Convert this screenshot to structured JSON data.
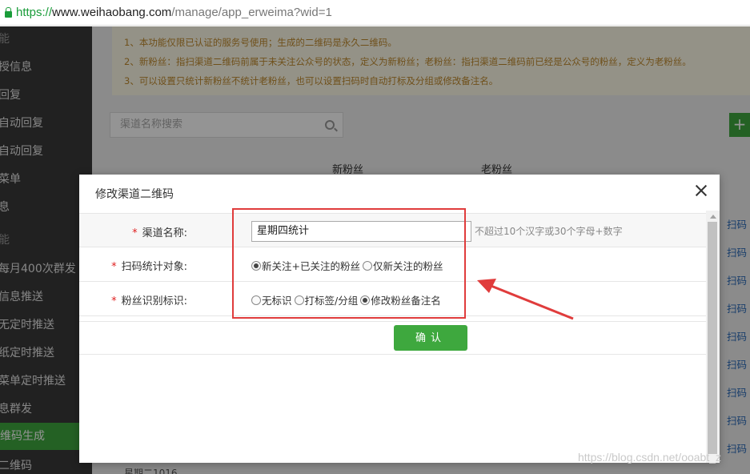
{
  "browser": {
    "url_scheme": "https://",
    "url_host": "www.weihaobang.com",
    "url_path": "/manage/app_erweima?wid=1"
  },
  "sidebar": {
    "items": [
      {
        "label": "能",
        "muted": true
      },
      {
        "label": "授信息"
      },
      {
        "label": "回复"
      },
      {
        "label": "自动回复"
      },
      {
        "label": "自动回复"
      },
      {
        "label": "菜单"
      },
      {
        "label": "息"
      },
      {
        "label": "能",
        "muted": true
      },
      {
        "label": "每月400次群发"
      },
      {
        "label": "信息推送"
      },
      {
        "label": "无定时推送"
      },
      {
        "label": "纸定时推送"
      },
      {
        "label": "菜单定时推送"
      },
      {
        "label": "息群发"
      },
      {
        "label": "维码生成",
        "active": true
      },
      {
        "label": "二维码"
      }
    ]
  },
  "main": {
    "notice_lines": [
      "1、本功能仅限已认证的服务号使用；生成的二维码是永久二维码。",
      "2、新粉丝：指扫渠道二维码前属于未关注公众号的状态，定义为新粉丝；老粉丝：指扫渠道二维码前已经是公众号的粉丝，定义为老粉丝。",
      "3、可以设置只统计新粉丝不统计老粉丝，也可以设置扫码时自动打标及分组或修改备注名。"
    ],
    "search_placeholder": "渠道名称搜索",
    "add_label": "+",
    "col_new_fans": "新粉丝",
    "col_old_fans": "老粉丝",
    "row_link_label": "扫码",
    "bottom_row_text": "星期二1016"
  },
  "modal": {
    "title": "修改渠道二维码",
    "fields": {
      "name_label": "渠道名称:",
      "name_value": "星期四统计",
      "name_hint": "不超过10个汉字或30个字母+数字",
      "target_label": "扫码统计对象:",
      "target_options": [
        {
          "label": "新关注+已关注的粉丝",
          "selected": true
        },
        {
          "label": "仅新关注的粉丝",
          "selected": false
        }
      ],
      "tag_label": "粉丝识别标识:",
      "tag_options": [
        {
          "label": "无标识",
          "selected": false
        },
        {
          "label": "打标签/分组",
          "selected": false
        },
        {
          "label": "修改粉丝备注名",
          "selected": true
        }
      ]
    },
    "confirm_label": "确认"
  },
  "annotation": {
    "highlight_color": "#e03c3c"
  },
  "watermark": "https://blog.csdn.net/ooabt_z",
  "colors": {
    "accent_green": "#3ea83e",
    "required_red": "#e02020"
  }
}
